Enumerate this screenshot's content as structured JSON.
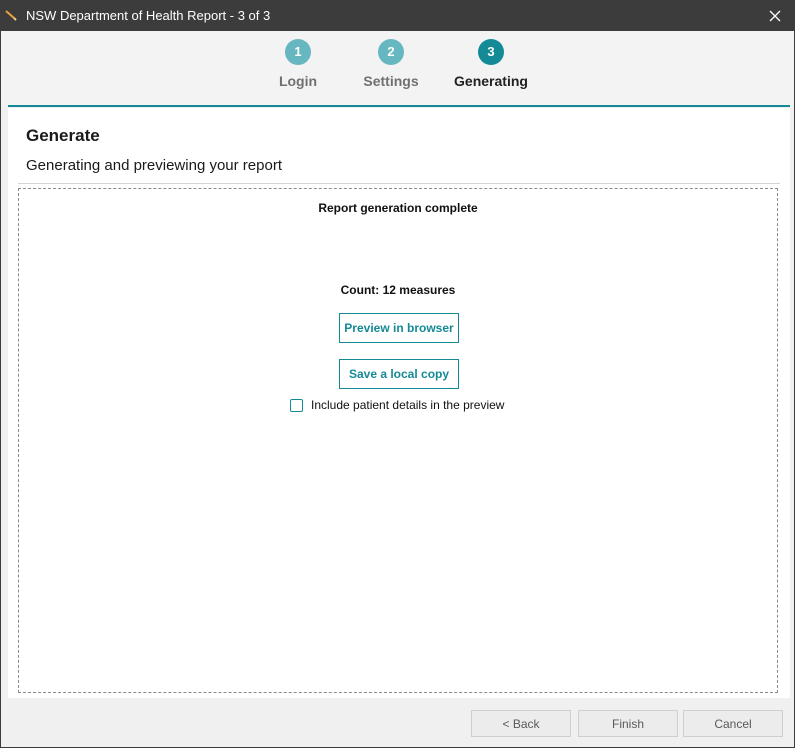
{
  "window": {
    "title": "NSW Department of Health Report - 3 of 3",
    "icon": "app-pen-icon",
    "close_icon": "close-icon"
  },
  "steps": [
    {
      "number": "1",
      "label": "Login",
      "state": "done"
    },
    {
      "number": "2",
      "label": "Settings",
      "state": "done"
    },
    {
      "number": "3",
      "label": "Generating",
      "state": "active"
    }
  ],
  "page": {
    "title": "Generate",
    "subtitle": "Generating and previewing your report"
  },
  "content": {
    "status": "Report generation complete",
    "count": "Count: 12 measures",
    "preview_button": "Preview in browser",
    "save_button": "Save a local copy",
    "checkbox_label": "Include patient details in the preview",
    "checkbox_checked": false
  },
  "footer": {
    "back": "< Back",
    "finish": "Finish",
    "cancel": "Cancel"
  },
  "colors": {
    "accent": "#158a97",
    "step_done": "#67b7c1",
    "titlebar": "#3c3c3c"
  }
}
